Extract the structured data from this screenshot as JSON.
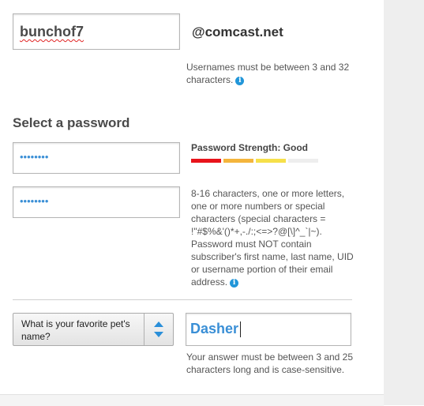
{
  "username": {
    "value": "bunchof7",
    "domain": "@comcast.net",
    "helper": "Usernames must be between 3 and 32 characters."
  },
  "password": {
    "section_title": "Select a password",
    "masked_value": "••••••••",
    "confirm_masked_value": "••••••••",
    "strength_label": "Password Strength: Good",
    "strength_colors": [
      "#e8141b",
      "#f4b53c",
      "#f6e04a",
      "#eeeeee"
    ],
    "rules": "8-16 characters, one or more letters, one or more numbers or special characters (special characters = !\"#$%&'()*+,-./:;<=>?@[\\]^_`|~). Password must NOT contain subscriber's first name, last name, UID or username portion of their email address."
  },
  "security_question": {
    "selected_question": "What is your favorite pet's name?",
    "answer_value": "Dasher",
    "answer_helper": "Your answer must be between 3 and 25 characters long and is case-sensitive."
  },
  "icons": {
    "info": "info-icon",
    "select_arrows": "up-down-arrows-icon"
  }
}
